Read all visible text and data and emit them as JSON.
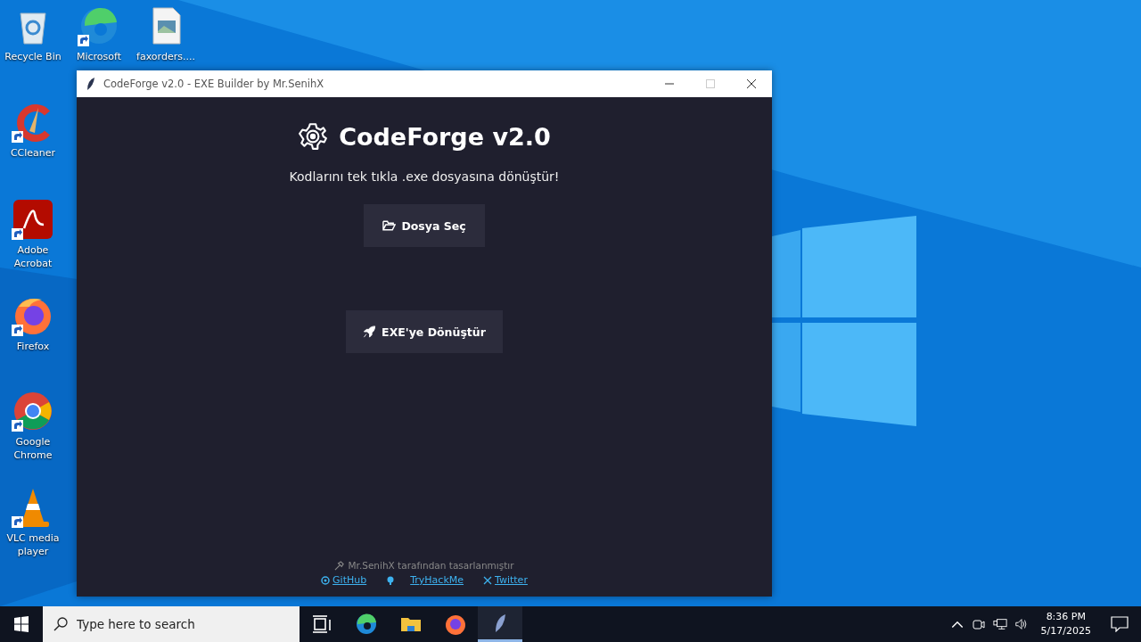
{
  "desktop": {
    "icons": [
      {
        "label": "Recycle Bin",
        "kind": "recycle",
        "shortcut": false
      },
      {
        "label": "Microsoft",
        "kind": "edge",
        "shortcut": true
      },
      {
        "label": "faxorders....",
        "kind": "image-file",
        "shortcut": false
      },
      {
        "label": "CCleaner",
        "kind": "ccleaner",
        "shortcut": true
      },
      {
        "label": "Adobe Acrobat",
        "kind": "acrobat",
        "shortcut": true
      },
      {
        "label": "Firefox",
        "kind": "firefox",
        "shortcut": true
      },
      {
        "label": "Google Chrome",
        "kind": "chrome",
        "shortcut": true
      },
      {
        "label": "VLC media player",
        "kind": "vlc",
        "shortcut": true
      }
    ]
  },
  "window": {
    "title": "CodeForge v2.0 - EXE Builder by Mr.SenihX",
    "heading": "CodeForge v2.0",
    "subtitle": "Kodlarını tek tıkla .exe dosyasına dönüştür!",
    "buttons": [
      {
        "label": "Dosya Seç",
        "kind": "folder"
      },
      {
        "label": "EXE'ye Dönüştür",
        "kind": "rocket"
      }
    ],
    "credit": "Mr.SenihX tarafından tasarlanmıştır",
    "links": [
      {
        "label": "GitHub",
        "kind": "github"
      },
      {
        "label": "TryHackMe",
        "kind": "thm"
      },
      {
        "label": "Twitter",
        "kind": "x"
      }
    ]
  },
  "taskbar": {
    "search": {
      "placeholder": "Type here to search"
    },
    "apps": [
      {
        "kind": "taskview",
        "selected": false
      },
      {
        "kind": "edge",
        "selected": false
      },
      {
        "kind": "explorer",
        "selected": false
      },
      {
        "kind": "firefox",
        "selected": false
      },
      {
        "kind": "feather",
        "selected": true
      }
    ],
    "time": "8:36 PM",
    "date": "5/17/2025"
  }
}
